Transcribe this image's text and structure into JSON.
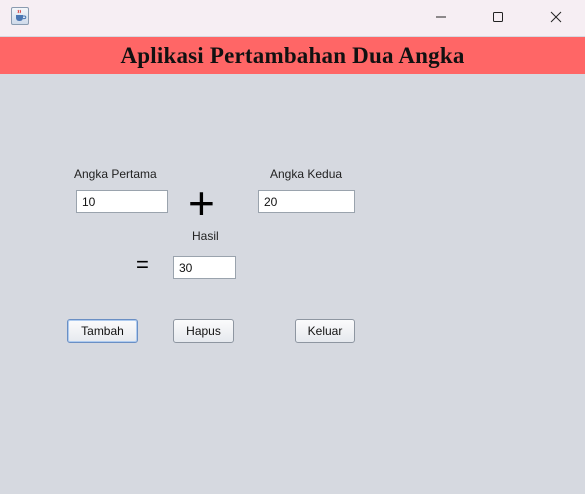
{
  "window": {
    "title": "",
    "icon": "java-cup-icon"
  },
  "header": {
    "title": "Aplikasi Pertambahan Dua Angka"
  },
  "form": {
    "first_label": "Angka Pertama",
    "first_value": "10",
    "plus_symbol": "+",
    "second_label": "Angka Kedua",
    "second_value": "20",
    "result_label": "Hasil",
    "equals_symbol": "=",
    "result_value": "30"
  },
  "buttons": {
    "add_label": "Tambah",
    "clear_label": "Hapus",
    "exit_label": "Keluar"
  },
  "colors": {
    "header_bg": "#ff6666",
    "window_bg": "#d6d9e0",
    "titlebar_bg": "#f6eef3"
  }
}
